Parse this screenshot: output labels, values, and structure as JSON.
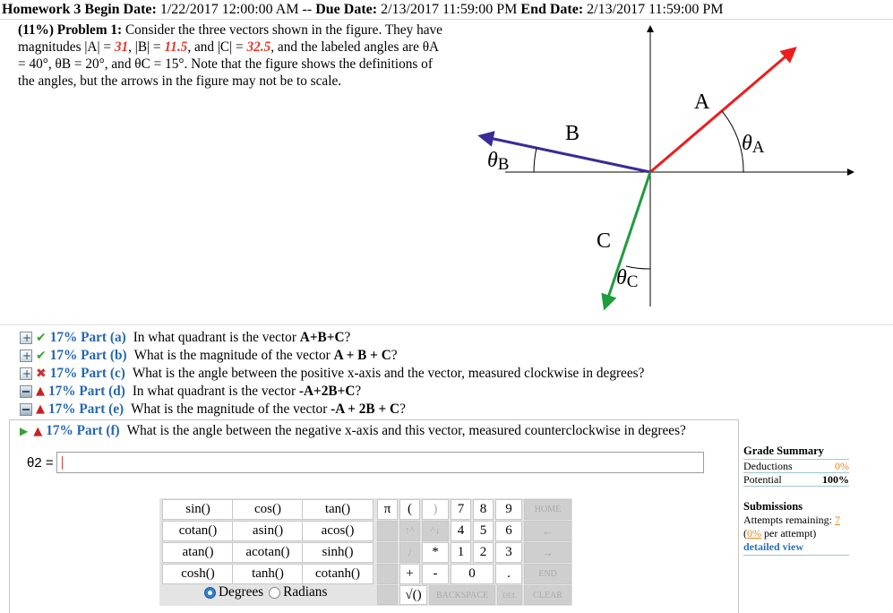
{
  "header": {
    "label1": "Homework 3 Begin Date:",
    "begin": "1/22/2017 12:00:00 AM",
    "sep": "--",
    "label2": "Due Date:",
    "due": "2/13/2017 11:59:00 PM",
    "label3": "End Date:",
    "end": "2/13/2017 11:59:00 PM"
  },
  "problem": {
    "title": "(11%) Problem 1:",
    "text1": "Consider the three vectors shown in the figure. They have magnitudes |A| =",
    "A": "31",
    "text2": ", |B| =",
    "B": "11.5",
    "text3": ", and |C| =",
    "C": "32.5",
    "text4": ", and the labeled angles are θA = 40°, θB = 20°, and θC = 15°. Note that the figure shows the definitions of the angles, but the arrows in the figure may not be to scale."
  },
  "figure": {
    "label_A": "A",
    "label_B": "B",
    "label_C": "C",
    "theta": "θ",
    "sub_A": "A",
    "sub_B": "B",
    "sub_C": "C",
    "colors": {
      "A": "#ee1c1c",
      "B": "#3a2a9a",
      "C": "#1e9c3e"
    }
  },
  "parts": [
    {
      "status": "check",
      "label": "17% Part (a)",
      "text": "In what quadrant is the vector",
      "bold": "A+B+C",
      "tail": "?"
    },
    {
      "status": "check",
      "label": "17% Part (b)",
      "text": "What is the magnitude of the vector",
      "bold": "A + B + C",
      "tail": "?"
    },
    {
      "status": "cross",
      "label": "17% Part (c)",
      "text": "What is the angle between the positive x-axis and the vector, measured clockwise in degrees?",
      "bold": "",
      "tail": ""
    },
    {
      "status": "warn",
      "label": "17% Part (d)",
      "text": "In what quadrant is the vector",
      "bold": "-A+2B+C",
      "tail": "?"
    },
    {
      "status": "warn",
      "label": "17% Part (e)",
      "text": "What is the magnitude of the vector",
      "bold": "-A + 2B + C",
      "tail": "?"
    }
  ],
  "current_part": {
    "label": "17% Part (f)",
    "text": "What is the angle between the negative x-axis and this vector, measured counterclockwise in degrees?",
    "input_label": "θ2 =",
    "input_value": ""
  },
  "grade": {
    "title": "Grade Summary",
    "deductions_label": "Deductions",
    "deductions_value": "0%",
    "potential_label": "Potential",
    "potential_value": "100%"
  },
  "submissions": {
    "title": "Submissions",
    "attempts_label": "Attempts remaining:",
    "attempts_value": "7",
    "per_attempt_open": "(",
    "per_attempt_value": "0%",
    "per_attempt_text": "per attempt)",
    "detail_link": "detailed view"
  },
  "calculator": {
    "functions": [
      [
        "sin()",
        "cos()",
        "tan()"
      ],
      [
        "cotan()",
        "asin()",
        "acos()"
      ],
      [
        "atan()",
        "acotan()",
        "sinh()"
      ],
      [
        "cosh()",
        "tanh()",
        "cotanh()"
      ]
    ],
    "pi": "π",
    "open_paren": "(",
    "close_paren": ")",
    "up": "↑^",
    "down": "^↓",
    "slash": "/",
    "star": "*",
    "plus": "+",
    "minus": "-",
    "sqrt": "√()",
    "digits": [
      [
        "7",
        "8",
        "9"
      ],
      [
        "4",
        "5",
        "6"
      ],
      [
        "1",
        "2",
        "3"
      ]
    ],
    "zero": "0",
    "dot": ".",
    "home": "HOME",
    "left": "←",
    "right": "→",
    "end": "END",
    "backspace": "BACKSPACE",
    "del": "DEL",
    "clear": "CLEAR",
    "degrees": "Degrees",
    "radians": "Radians"
  }
}
